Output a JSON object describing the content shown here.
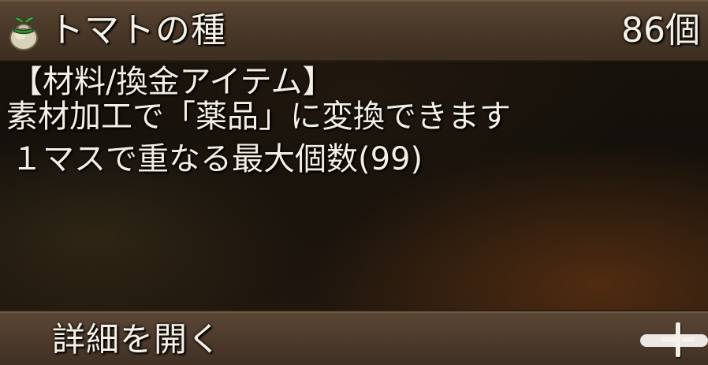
{
  "item": {
    "icon": "seed-bag-icon",
    "name": "トマトの種",
    "count": "86個"
  },
  "description": {
    "category": "【材料/換金アイテム】",
    "usage": "素材加工で「薬品」に変換できます",
    "stack": "１マスで重なる最大個数(99)"
  },
  "footer": {
    "label": "詳細を開く",
    "expand_icon": "plus-icon"
  },
  "colors": {
    "text": "#f6f1e6",
    "header_bg": "#4b3929",
    "body_bg": "#14100b"
  }
}
